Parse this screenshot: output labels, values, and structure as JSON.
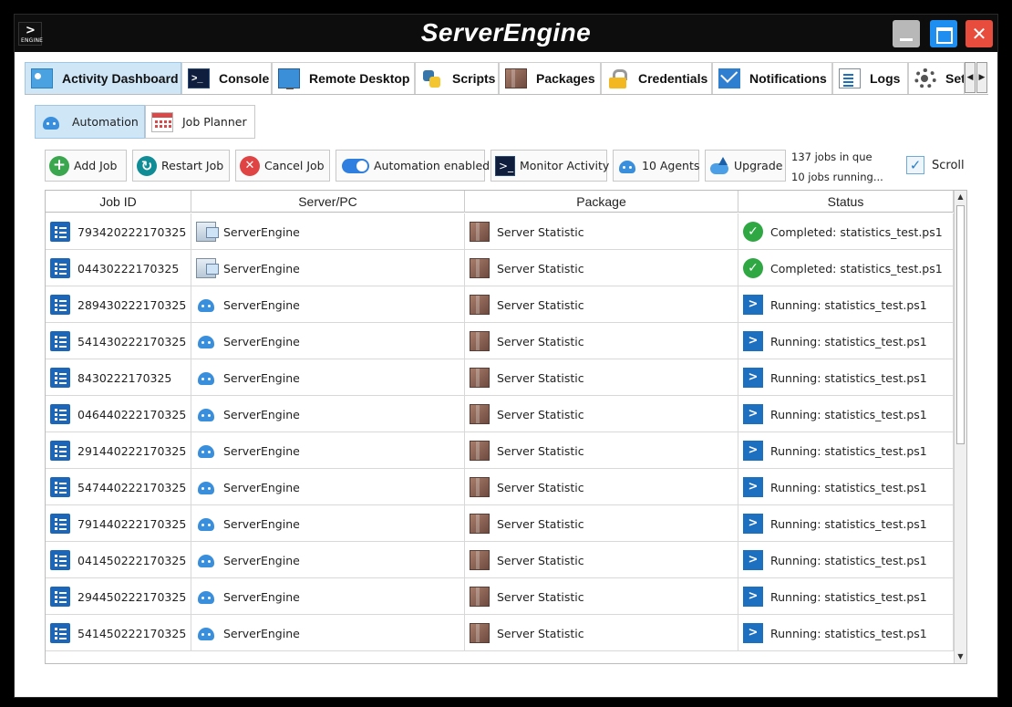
{
  "app": {
    "title": "ServerEngine",
    "icon_label": "ENGINE"
  },
  "window_controls": {
    "close": "✕"
  },
  "tabs": [
    {
      "label": "Activity Dashboard",
      "icon": "dashboard-icon",
      "active": true
    },
    {
      "label": "Console",
      "icon": "console-icon"
    },
    {
      "label": "Remote Desktop",
      "icon": "remote-desktop-icon"
    },
    {
      "label": "Scripts",
      "icon": "scripts-icon"
    },
    {
      "label": "Packages",
      "icon": "package-icon"
    },
    {
      "label": "Credentials",
      "icon": "lock-icon"
    },
    {
      "label": "Notifications",
      "icon": "mail-icon"
    },
    {
      "label": "Logs",
      "icon": "logs-icon"
    },
    {
      "label": "Settings",
      "icon": "gear-icon"
    }
  ],
  "tab_nav": {
    "prev": "◀",
    "next": "▶"
  },
  "subtabs": [
    {
      "label": "Automation",
      "icon": "robot-icon",
      "active": true
    },
    {
      "label": "Job Planner",
      "icon": "calendar-icon"
    }
  ],
  "toolbar": {
    "add_job": "Add Job",
    "restart_job": "Restart Job",
    "cancel_job": "Cancel Job",
    "automation_toggle": "Automation enabled",
    "monitor_activity": "Monitor Activity",
    "agents": "10 Agents",
    "upgrade": "Upgrade",
    "jobs_queued": "137 jobs in que",
    "jobs_running": "10 jobs running...",
    "scroll_label": "Scroll",
    "scroll_checked": true,
    "automation_enabled": true
  },
  "grid": {
    "columns": [
      "Job ID",
      "Server/PC",
      "Package",
      "Status"
    ],
    "rows": [
      {
        "job_id": "793420222170325",
        "server": "ServerEngine",
        "server_icon": "server-icon",
        "package": "Server Statistic",
        "status": "Completed: statistics_test.ps1",
        "status_icon": "check-icon"
      },
      {
        "job_id": "04430222170325",
        "server": "ServerEngine",
        "server_icon": "server-icon",
        "package": "Server Statistic",
        "status": "Completed: statistics_test.ps1",
        "status_icon": "check-icon"
      },
      {
        "job_id": "289430222170325",
        "server": "ServerEngine",
        "server_icon": "robot-icon",
        "package": "Server Statistic",
        "status": "Running: statistics_test.ps1",
        "status_icon": "powershell-icon"
      },
      {
        "job_id": "541430222170325",
        "server": "ServerEngine",
        "server_icon": "robot-icon",
        "package": "Server Statistic",
        "status": "Running: statistics_test.ps1",
        "status_icon": "powershell-icon"
      },
      {
        "job_id": "8430222170325",
        "server": "ServerEngine",
        "server_icon": "robot-icon",
        "package": "Server Statistic",
        "status": "Running: statistics_test.ps1",
        "status_icon": "powershell-icon"
      },
      {
        "job_id": "046440222170325",
        "server": "ServerEngine",
        "server_icon": "robot-icon",
        "package": "Server Statistic",
        "status": "Running: statistics_test.ps1",
        "status_icon": "powershell-icon"
      },
      {
        "job_id": "291440222170325",
        "server": "ServerEngine",
        "server_icon": "robot-icon",
        "package": "Server Statistic",
        "status": "Running: statistics_test.ps1",
        "status_icon": "powershell-icon"
      },
      {
        "job_id": "547440222170325",
        "server": "ServerEngine",
        "server_icon": "robot-icon",
        "package": "Server Statistic",
        "status": "Running: statistics_test.ps1",
        "status_icon": "powershell-icon"
      },
      {
        "job_id": "791440222170325",
        "server": "ServerEngine",
        "server_icon": "robot-icon",
        "package": "Server Statistic",
        "status": "Running: statistics_test.ps1",
        "status_icon": "powershell-icon"
      },
      {
        "job_id": "041450222170325",
        "server": "ServerEngine",
        "server_icon": "robot-icon",
        "package": "Server Statistic",
        "status": "Running: statistics_test.ps1",
        "status_icon": "powershell-icon"
      },
      {
        "job_id": "294450222170325",
        "server": "ServerEngine",
        "server_icon": "robot-icon",
        "package": "Server Statistic",
        "status": "Running: statistics_test.ps1",
        "status_icon": "powershell-icon"
      },
      {
        "job_id": "541450222170325",
        "server": "ServerEngine",
        "server_icon": "robot-icon",
        "package": "Server Statistic",
        "status": "Running: statistics_test.ps1",
        "status_icon": "powershell-icon"
      }
    ]
  },
  "colors": {
    "accent": "#1e8ef0",
    "active_tab": "#cfe6f7",
    "close": "#e74c3c",
    "success": "#2fa844",
    "powershell": "#1d6fc0"
  }
}
